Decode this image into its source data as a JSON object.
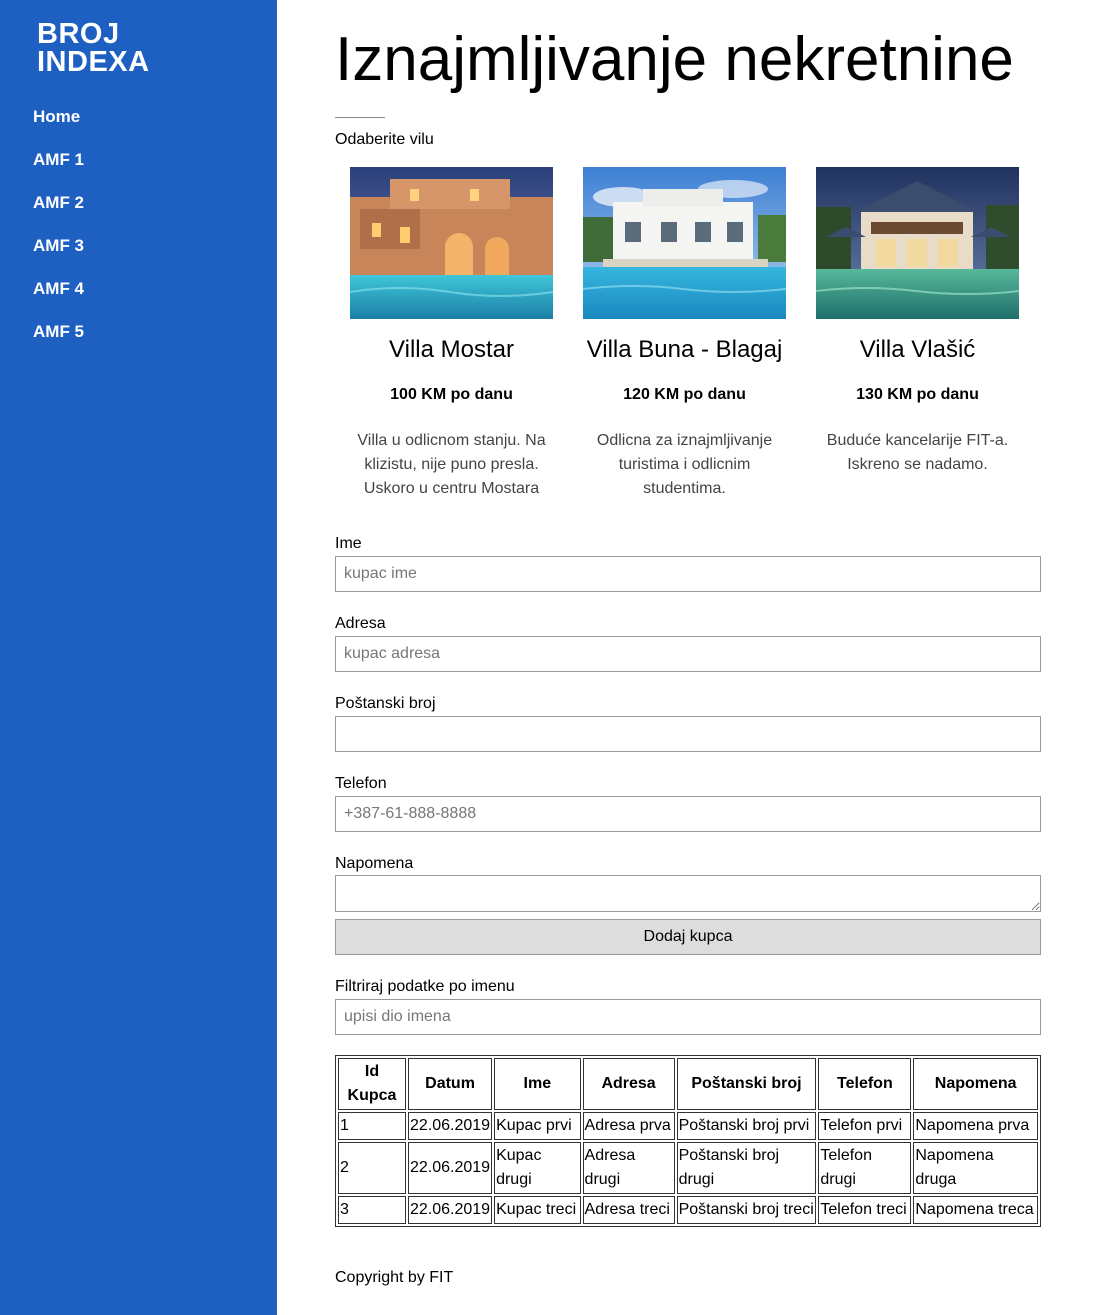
{
  "sidebar": {
    "brand": "BROJ INDEXA",
    "items": [
      {
        "label": "Home"
      },
      {
        "label": "AMF 1"
      },
      {
        "label": "AMF 2"
      },
      {
        "label": "AMF 3"
      },
      {
        "label": "AMF 4"
      },
      {
        "label": "AMF 5"
      }
    ]
  },
  "main": {
    "title": "Iznajmljivanje nekretnine",
    "choose_label": "Odaberite vilu",
    "villas": [
      {
        "name": "Villa Mostar",
        "price": "100 KM po danu",
        "description": "Villa u odlicnom stanju. Na klizistu, nije puno presla. Uskoro u centru Mostara"
      },
      {
        "name": "Villa Buna - Blagaj",
        "price": "120 KM po danu",
        "description": "Odlicna za iznajmljivanje turistima i odlicnim studentima."
      },
      {
        "name": "Villa Vlašić",
        "price": "130 KM po danu",
        "description": "Buduće kancelarije FIT-a. Iskreno se nadamo."
      }
    ]
  },
  "form": {
    "ime_label": "Ime",
    "ime_placeholder": "kupac ime",
    "adresa_label": "Adresa",
    "adresa_placeholder": "kupac adresa",
    "postanski_label": "Poštanski broj",
    "postanski_placeholder": "",
    "telefon_label": "Telefon",
    "telefon_placeholder": "+387-61-888-8888",
    "napomena_label": "Napomena",
    "submit_label": "Dodaj kupca"
  },
  "filter": {
    "label": "Filtriraj podatke po imenu",
    "placeholder": "upisi dio imena"
  },
  "table": {
    "headers": [
      "Id Kupca",
      "Datum",
      "Ime",
      "Adresa",
      "Poštanski broj",
      "Telefon",
      "Napomena"
    ],
    "rows": [
      [
        "1",
        "22.06.2019",
        "Kupac prvi",
        "Adresa prva",
        "Poštanski broj prvi",
        "Telefon prvi",
        "Napomena prva"
      ],
      [
        "2",
        "22.06.2019",
        "Kupac drugi",
        "Adresa drugi",
        "Poštanski broj drugi",
        "Telefon drugi",
        "Napomena druga"
      ],
      [
        "3",
        "22.06.2019",
        "Kupac treci",
        "Adresa treci",
        "Poštanski broj treci",
        "Telefon treci",
        "Napomena treca"
      ]
    ]
  },
  "footer": {
    "text": "Copyright by FIT"
  },
  "colors": {
    "sidebar": "#1e5fc2",
    "button": "#dddddd"
  }
}
